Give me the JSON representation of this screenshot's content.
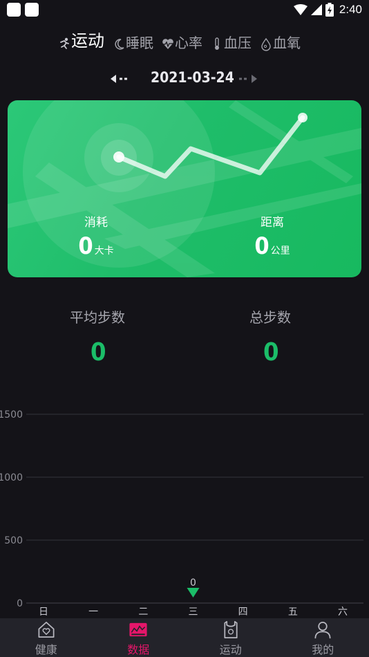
{
  "status_bar": {
    "time": "2:40"
  },
  "tabs": [
    {
      "label": "运动",
      "icon": "running-icon",
      "active": true
    },
    {
      "label": "睡眠",
      "icon": "moon-icon",
      "active": false
    },
    {
      "label": "心率",
      "icon": "heart-rate-icon",
      "active": false
    },
    {
      "label": "血压",
      "icon": "thermometer-icon",
      "active": false
    },
    {
      "label": "血氧",
      "icon": "oxygen-drop-icon",
      "active": false
    }
  ],
  "date_nav": {
    "date": "2021-03-24"
  },
  "card": {
    "calories": {
      "label": "消耗",
      "value": "0",
      "unit": "大卡"
    },
    "distance": {
      "label": "距离",
      "value": "0",
      "unit": "公里"
    },
    "colors": {
      "start": "#2cc878",
      "end": "#17b95f"
    }
  },
  "steps": {
    "average": {
      "label": "平均步数",
      "value": "0"
    },
    "total": {
      "label": "总步数",
      "value": "0"
    }
  },
  "chart_data": {
    "type": "bar",
    "categories": [
      "日",
      "一",
      "二",
      "三",
      "四",
      "五",
      "六"
    ],
    "values": [
      0,
      0,
      0,
      0,
      0,
      0,
      0
    ],
    "yticks": [
      0,
      500,
      1000,
      1500
    ],
    "ylim": [
      0,
      1500
    ],
    "grid": true,
    "selected_index": 3,
    "selected_label": "0",
    "marker_color": "#1bbd68"
  },
  "bottom_nav": [
    {
      "label": "健康",
      "icon": "health-house-icon",
      "active": false
    },
    {
      "label": "数据",
      "icon": "data-chart-icon",
      "active": true
    },
    {
      "label": "运动",
      "icon": "sport-vest-icon",
      "active": false
    },
    {
      "label": "我的",
      "icon": "profile-icon",
      "active": false
    }
  ],
  "colors": {
    "accent": "#e5166a",
    "green": "#1bbd68",
    "background": "#141318"
  }
}
